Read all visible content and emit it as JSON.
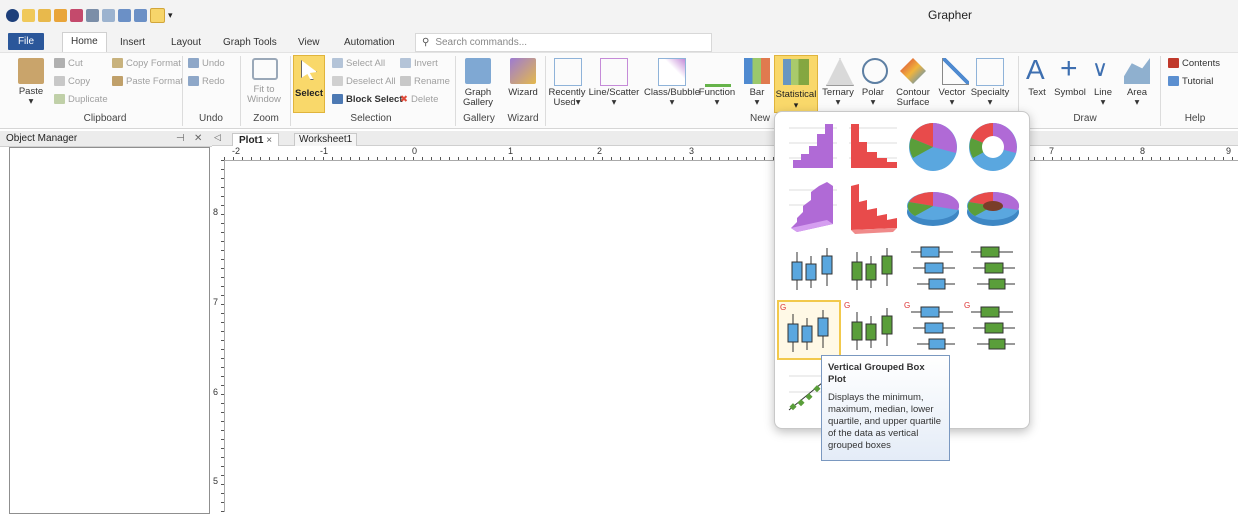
{
  "app_title": "Grapher",
  "tabs": [
    "File",
    "Home",
    "Insert",
    "Layout",
    "Graph Tools",
    "View",
    "Automation"
  ],
  "search_placeholder": "Search commands...",
  "clipboard": {
    "paste": "Paste",
    "cut": "Cut",
    "copy": "Copy",
    "duplicate": "Duplicate",
    "copy_format": "Copy Format",
    "paste_format": "Paste Format",
    "group": "Clipboard"
  },
  "undo": {
    "undo": "Undo",
    "redo": "Redo",
    "group": "Undo"
  },
  "zoom": {
    "fit": "Fit to Window",
    "group": "Zoom"
  },
  "selection": {
    "select": "Select",
    "select_all": "Select All",
    "deselect_all": "Deselect All",
    "block_select": "Block Select",
    "invert": "Invert",
    "rename": "Rename",
    "delete": "Delete",
    "group": "Selection"
  },
  "gallery_group": {
    "graph_gallery": "Graph Gallery",
    "group": "Gallery"
  },
  "wizard_group": {
    "wizard": "Wizard",
    "group": "Wizard"
  },
  "new_graph": {
    "recently_used": "Recently Used",
    "line_scatter": "Line/Scatter",
    "class_bubble": "Class/Bubble",
    "function": "Function",
    "bar": "Bar",
    "statistical": "Statistical",
    "ternary": "Ternary",
    "polar": "Polar",
    "contour_surface": "Contour Surface",
    "vector": "Vector",
    "specialty": "Specialty",
    "group": "New"
  },
  "draw": {
    "text": "Text",
    "symbol": "Symbol",
    "line": "Line",
    "area": "Area",
    "group": "Draw"
  },
  "help": {
    "contents": "Contents",
    "tutorial": "Tutorial",
    "group": "Help"
  },
  "object_manager": {
    "title": "Object Manager"
  },
  "doc_tabs": {
    "plot": "Plot1",
    "worksheet": "Worksheet1"
  },
  "ruler": {
    "h": [
      "-2",
      "-1",
      "0",
      "1",
      "2",
      "3",
      "7",
      "8",
      "9"
    ],
    "v": [
      "8",
      "7",
      "6",
      "5"
    ]
  },
  "tooltip": {
    "title": "Vertical Grouped Box Plot",
    "body": "Displays the minimum, maximum, median, lower quartile, and upper quartile of the data as vertical grouped boxes"
  },
  "colors": {
    "accent": "#2b579a",
    "highlight": "#f2c94c",
    "purple": "#b06ad6",
    "red": "#e84b4b",
    "blue": "#5aa7df",
    "green": "#5a9e3a"
  }
}
